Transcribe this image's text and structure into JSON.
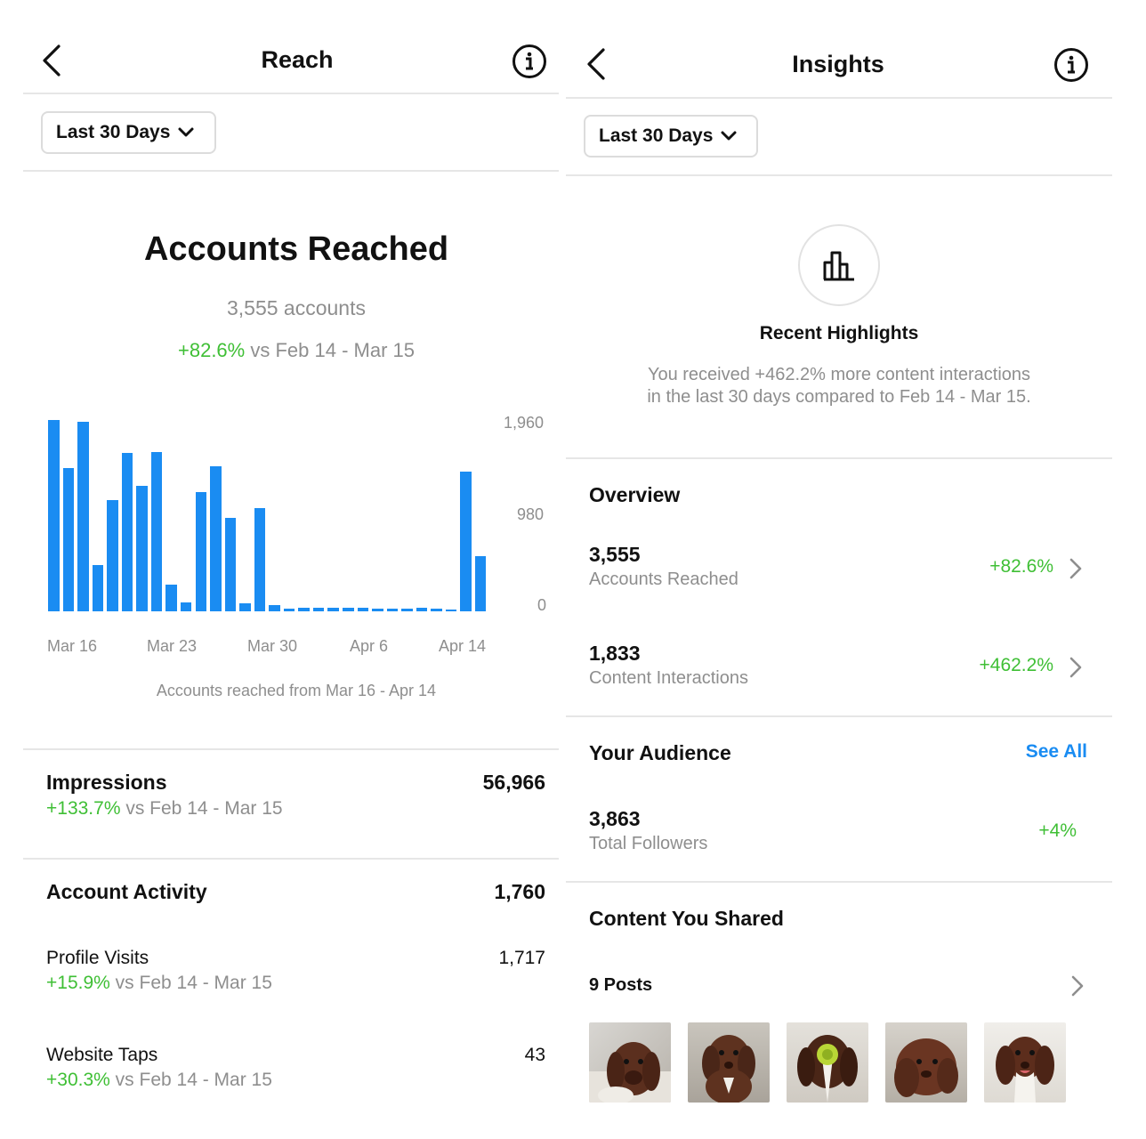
{
  "left": {
    "header": {
      "title": "Reach"
    },
    "filter": {
      "label": "Last 30 Days"
    },
    "reach": {
      "title": "Accounts Reached",
      "count": "3,555 accounts",
      "change": "+82.6%",
      "compare": "vs Feb 14 - Mar 15"
    },
    "chart_caption": "Accounts reached from Mar 16 - Apr 14",
    "impressions": {
      "label": "Impressions",
      "value": "56,966",
      "change": "+133.7%",
      "compare": "vs Feb 14 - Mar 15"
    },
    "account_activity": {
      "label": "Account Activity",
      "value": "1,760"
    },
    "profile_visits": {
      "label": "Profile Visits",
      "value": "1,717",
      "change": "+15.9%",
      "compare": "vs Feb 14 - Mar 15"
    },
    "website_taps": {
      "label": "Website Taps",
      "value": "43",
      "change": "+30.3%",
      "compare": "vs Feb 14 - Mar 15"
    }
  },
  "right": {
    "header": {
      "title": "Insights"
    },
    "filter": {
      "label": "Last 30 Days"
    },
    "highlights": {
      "title": "Recent Highlights",
      "line1": "You received +462.2% more content interactions",
      "line2": "in the last 30 days compared to Feb 14 - Mar 15."
    },
    "overview": {
      "title": "Overview",
      "rows": [
        {
          "value": "3,555",
          "label": "Accounts Reached",
          "change": "+82.6%"
        },
        {
          "value": "1,833",
          "label": "Content Interactions",
          "change": "+462.2%"
        }
      ]
    },
    "audience": {
      "title": "Your Audience",
      "see_all": "See All",
      "value": "3,863",
      "label": "Total Followers",
      "change": "+4%"
    },
    "content": {
      "title": "Content You Shared",
      "posts": "9 Posts"
    }
  },
  "chart_data": {
    "type": "bar",
    "x_tick_labels": [
      "Mar 16",
      "Mar 23",
      "Mar 30",
      "Apr 6",
      "Apr 14"
    ],
    "y_tick_labels": [
      "1,960",
      "980",
      "0"
    ],
    "ylim": [
      0,
      1960
    ],
    "values": [
      2010,
      1500,
      1990,
      490,
      1170,
      1660,
      1320,
      1670,
      280,
      90,
      1250,
      1520,
      980,
      80,
      1080,
      70,
      25,
      40,
      35,
      35,
      35,
      35,
      25,
      25,
      25,
      40,
      25,
      15,
      1470,
      580
    ],
    "bar_color": "#1a8cf2",
    "grid": false
  },
  "colors": {
    "accent": "#1a8cf2",
    "positive": "#3fbf35",
    "muted": "#8e8e8e"
  }
}
